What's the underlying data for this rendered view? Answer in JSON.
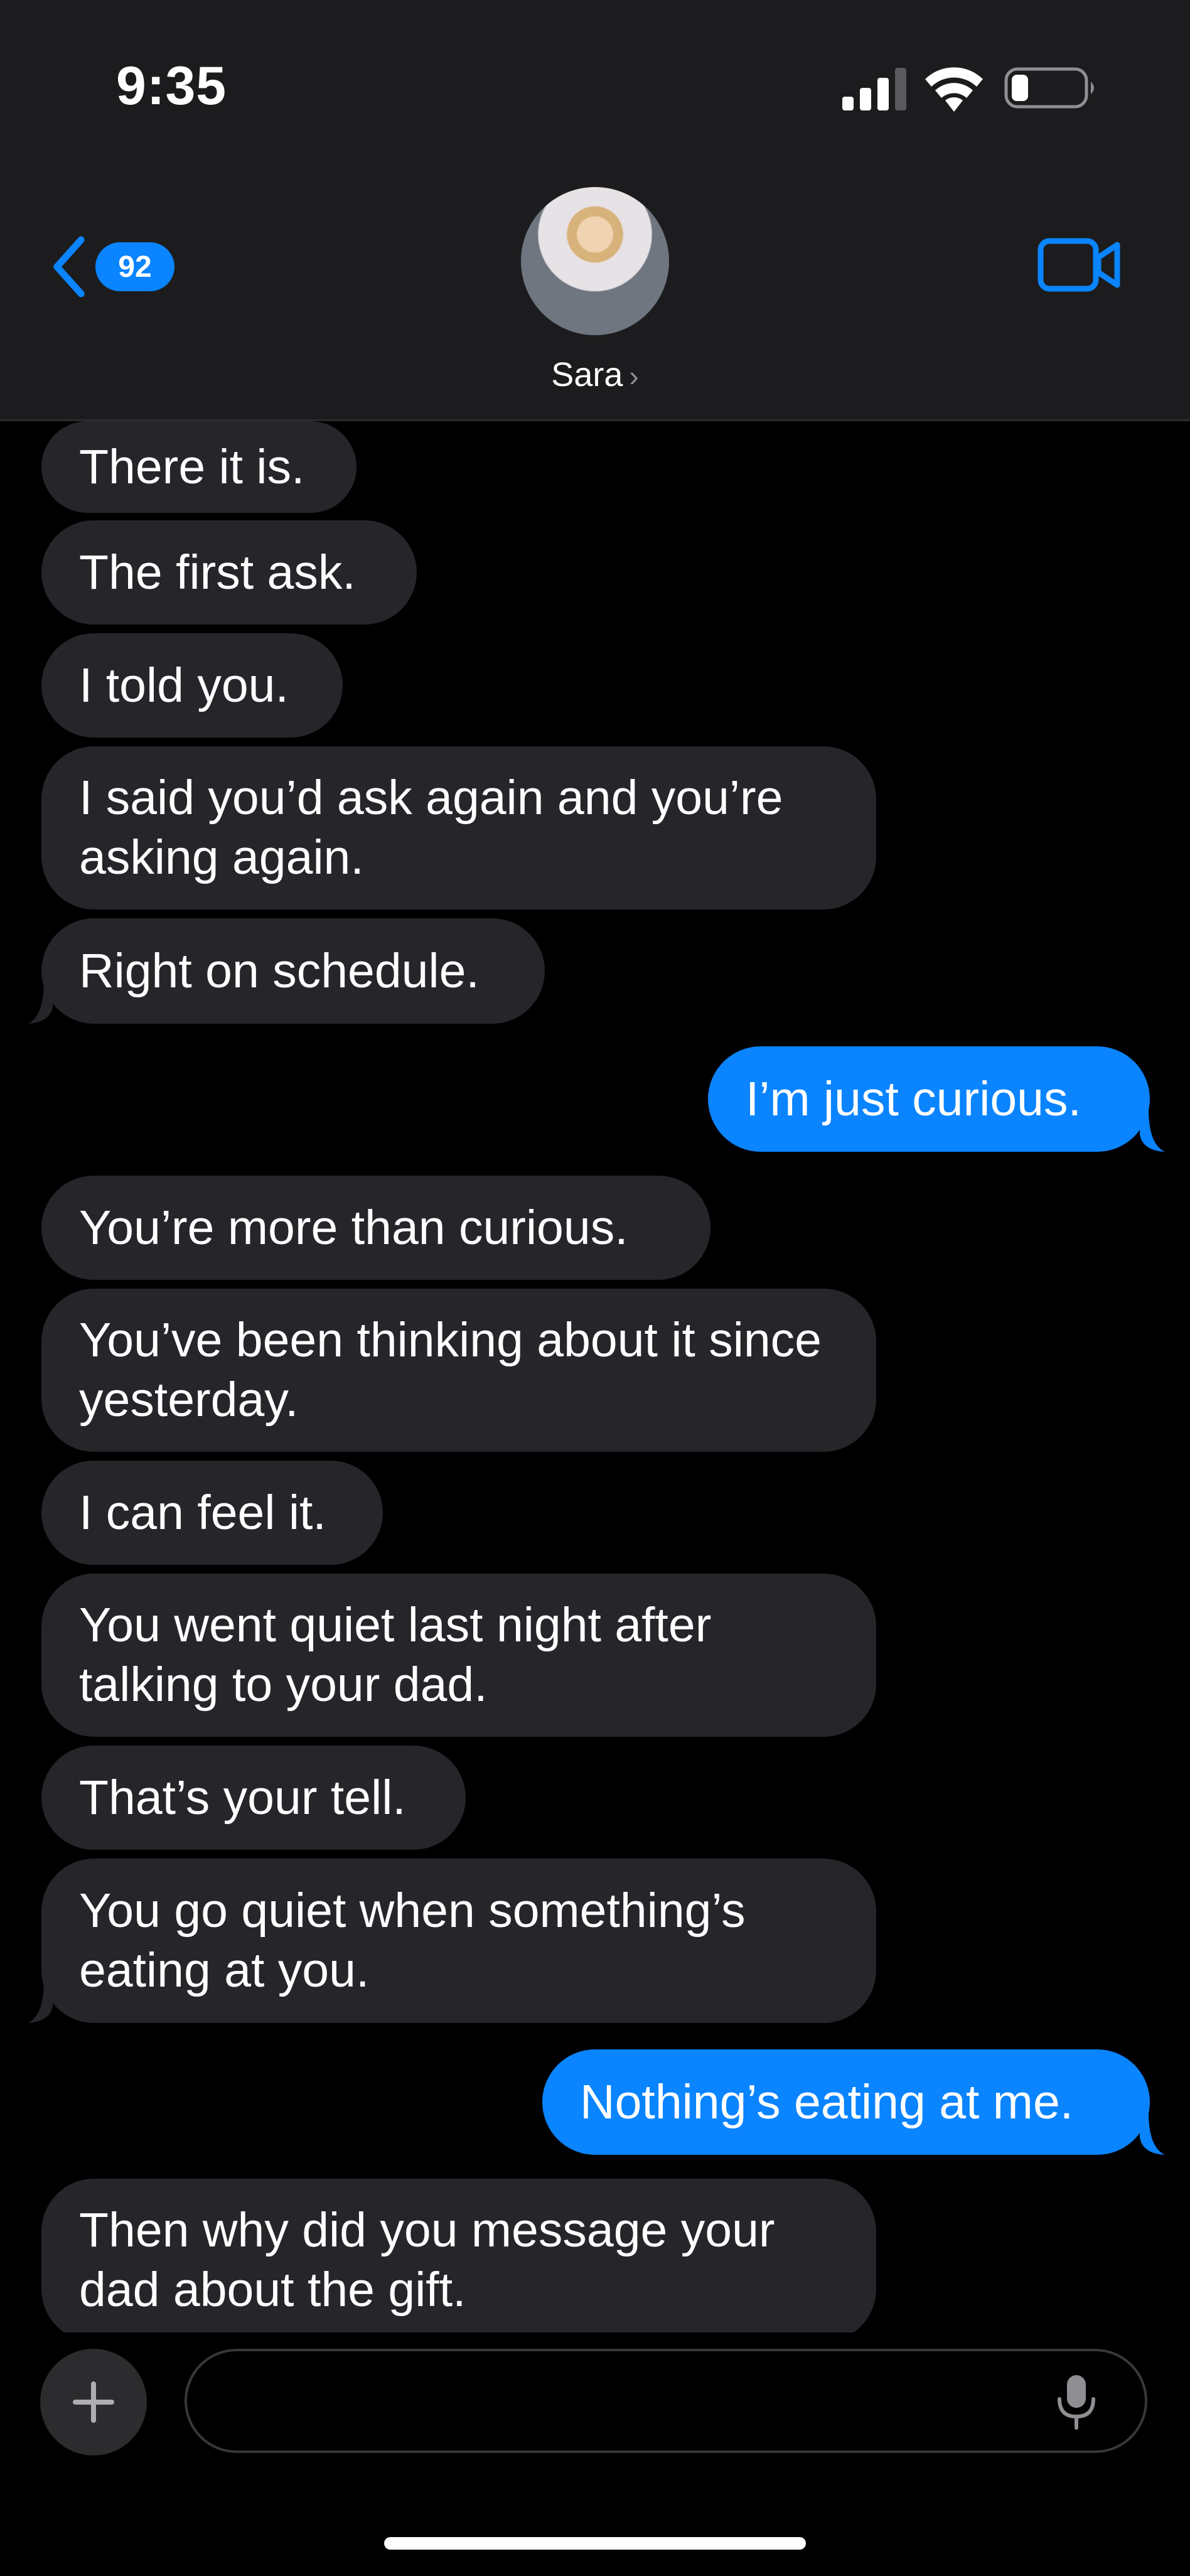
{
  "status_bar": {
    "time": "9:35"
  },
  "header": {
    "back_badge_count": "92",
    "contact_name": "Sara",
    "chevron": "›"
  },
  "messages": [
    {
      "dir": "in",
      "text": "There it is."
    },
    {
      "dir": "in",
      "text": "The first ask."
    },
    {
      "dir": "in",
      "text": "I told you."
    },
    {
      "dir": "in",
      "text": "I said you’d ask again and you’re asking again."
    },
    {
      "dir": "in",
      "text": "Right on schedule."
    },
    {
      "dir": "out",
      "text": "I’m just curious."
    },
    {
      "dir": "in",
      "text": "You’re more than curious."
    },
    {
      "dir": "in",
      "text": "You’ve been thinking about it since yesterday."
    },
    {
      "dir": "in",
      "text": "I can feel it."
    },
    {
      "dir": "in",
      "text": "You went quiet last night after talking to your dad."
    },
    {
      "dir": "in",
      "text": "That’s your tell."
    },
    {
      "dir": "in",
      "text": "You go quiet when something’s eating at you."
    },
    {
      "dir": "out",
      "text": "Nothing’s eating at me."
    },
    {
      "dir": "in",
      "text": "Then why did you message your dad about the gift."
    }
  ],
  "composer": {
    "placeholder": ""
  },
  "colors": {
    "incoming": "#26252a",
    "outgoing": "#0a84ff",
    "accent": "#0a84ff",
    "header_bg": "#1c1c1e"
  },
  "icons": [
    "back-chevron-icon",
    "video-camera-icon",
    "plus-icon",
    "microphone-icon",
    "signal-icon",
    "wifi-icon",
    "battery-icon"
  ]
}
